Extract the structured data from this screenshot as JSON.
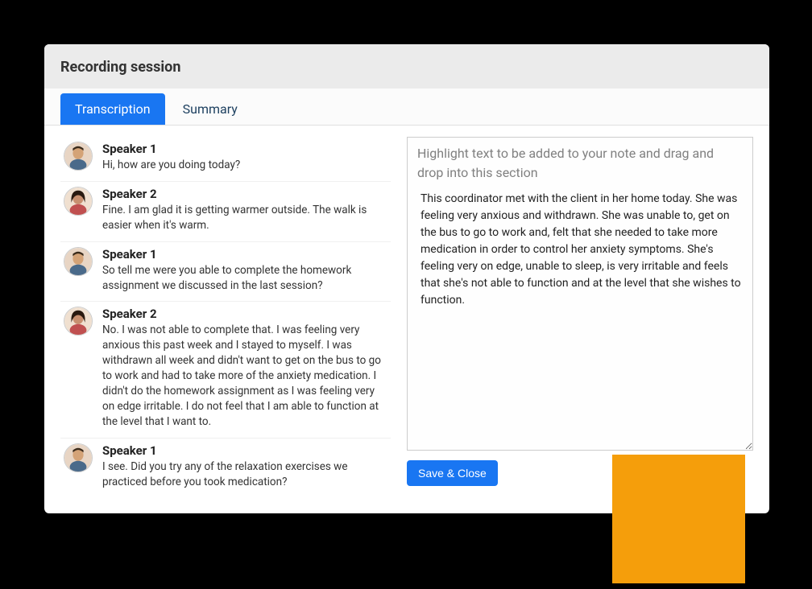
{
  "header": {
    "title": "Recording session"
  },
  "tabs": {
    "transcription": "Transcription",
    "summary": "Summary",
    "active": "transcription"
  },
  "transcript": [
    {
      "speaker": "Speaker 1",
      "avatar": "male",
      "text": "Hi, how are you doing today?"
    },
    {
      "speaker": "Speaker 2",
      "avatar": "female",
      "text": "Fine. I am glad it is getting warmer outside. The walk is easier when it's warm."
    },
    {
      "speaker": "Speaker 1",
      "avatar": "male",
      "text": "So tell me were you able to complete the homework assignment we discussed in the last session?"
    },
    {
      "speaker": "Speaker 2",
      "avatar": "female",
      "text": "No. I was not able to complete that. I was feeling very anxious this past week and I stayed to myself.  I was withdrawn all week and didn't want to get on the bus to go to work and had to take more of the anxiety medication. I didn't do the homework assignment as I was feeling very on edge irritable.  I do not feel that I am able to function at the level that I want to."
    },
    {
      "speaker": "Speaker 1",
      "avatar": "male",
      "text": "I see. Did you try any of the relaxation exercises we practiced before you took medication?"
    }
  ],
  "note": {
    "placeholder": "Highlight text to be added to your note and drag and drop into this section",
    "content": "This coordinator met with the client in her home today.  She was feeling very anxious and withdrawn. She was unable to, get on the bus to go to work and, felt that she needed to take more medication in order to control her anxiety symptoms. She's feeling very on edge, unable to sleep, is very irritable and feels that she's not able to function and at the level that she wishes to function."
  },
  "actions": {
    "save_close": "Save & Close"
  }
}
